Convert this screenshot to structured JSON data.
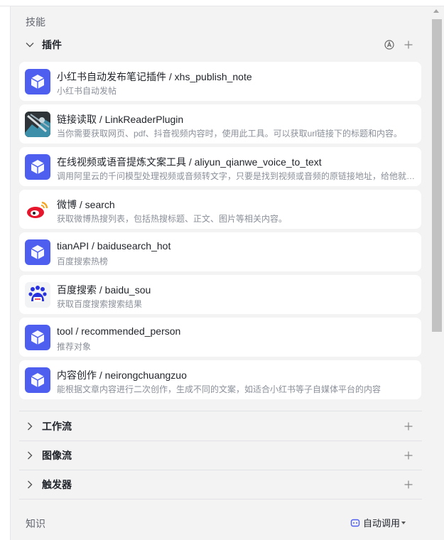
{
  "skills": {
    "title": "技能"
  },
  "plugins": {
    "label": "插件",
    "items": [
      {
        "name": "小红书自动发布笔记插件 / xhs_publish_note",
        "desc": "小红书自动发帖",
        "icon": "cube-icon"
      },
      {
        "name": "链接读取 / LinkReaderPlugin",
        "desc": "当你需要获取网页、pdf、抖音视频内容时，使用此工具。可以获取url链接下的标题和内容。",
        "icon": "link-reader-thumbnail"
      },
      {
        "name": "在线视频或语音提炼文案工具 / aliyun_qianwe_voice_to_text",
        "desc": "调用阿里云的千问模型处理视频或音频转文字，只要是找到视频或音频的原链接地址，给他就可以提炼文案",
        "icon": "cube-icon"
      },
      {
        "name": "微博 / search",
        "desc": "获取微博热搜列表，包括热搜标题、正文、图片等相关内容。",
        "icon": "weibo-icon"
      },
      {
        "name": "tianAPI / baidusearch_hot",
        "desc": "百度搜索热榜",
        "icon": "cube-icon"
      },
      {
        "name": "百度搜索 / baidu_sou",
        "desc": "获取百度搜索搜索结果",
        "icon": "baidu-icon"
      },
      {
        "name": "tool / recommended_person",
        "desc": "推荐对象",
        "icon": "cube-icon"
      },
      {
        "name": "内容创作 / neirongchuangzuo",
        "desc": "能根据文章内容进行二次创作，生成不同的文案，如适合小红书等子自媒体平台的内容",
        "icon": "cube-icon"
      }
    ]
  },
  "workflow": {
    "label": "工作流"
  },
  "imageflow": {
    "label": "图像流"
  },
  "trigger": {
    "label": "触发器"
  },
  "knowledge": {
    "title": "知识",
    "auto_call": "自动调用"
  },
  "colors": {
    "accent": "#4e5ff0",
    "weibo_red": "#e6162d",
    "baidu_blue": "#2932e1"
  }
}
